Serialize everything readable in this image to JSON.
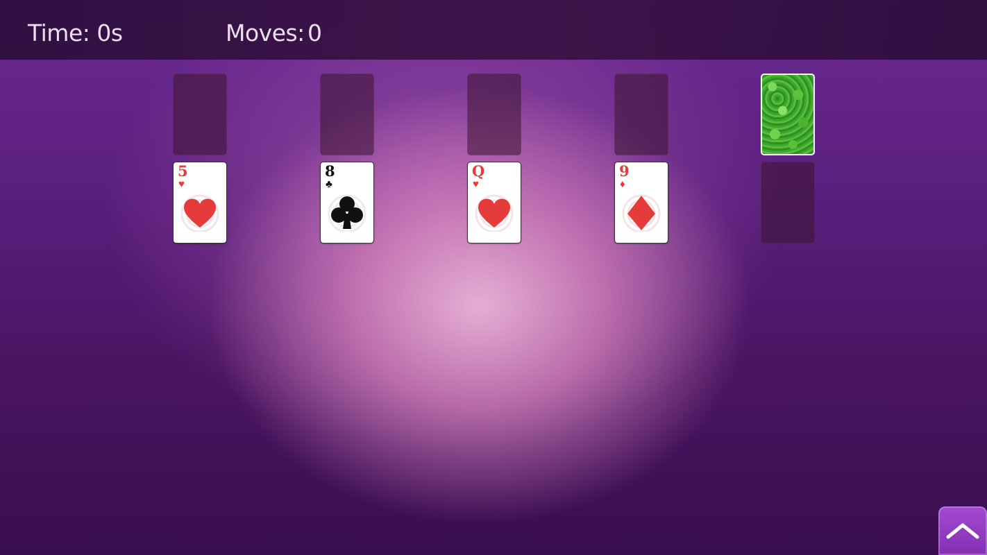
{
  "hud": {
    "time_label": "Time: 0s",
    "moves_label": "Moves:",
    "moves_value": "0"
  },
  "cards": [
    {
      "rank": "5",
      "suit": "hearts",
      "suit_symbol": "♥",
      "color": "#e53b3b"
    },
    {
      "rank": "8",
      "suit": "clubs",
      "suit_symbol": "♣",
      "color": "#111111"
    },
    {
      "rank": "Q",
      "suit": "hearts",
      "suit_symbol": "♥",
      "color": "#e53b3b"
    },
    {
      "rank": "9",
      "suit": "diamonds",
      "suit_symbol": "♦",
      "color": "#e53b3b"
    }
  ],
  "stock": {
    "back_pattern": "green-clover"
  },
  "controls": {
    "scroll_top_icon": "chevron-up-icon"
  }
}
